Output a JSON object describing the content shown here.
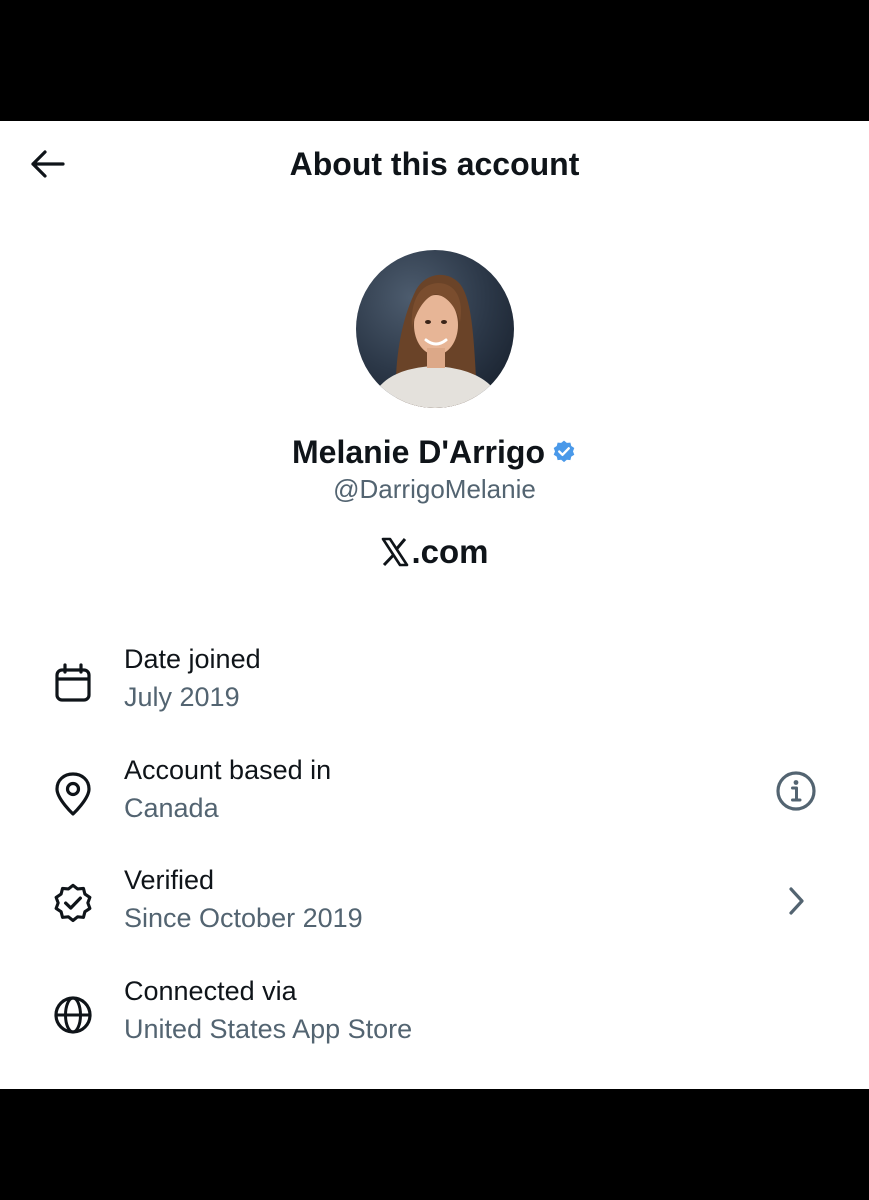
{
  "header": {
    "title": "About this account",
    "back_icon": "arrow-left-icon"
  },
  "profile": {
    "display_name": "Melanie D'Arrigo",
    "handle": "@DarrigoMelanie",
    "verified_color": "#4a99e9",
    "site_mark": "𝕏",
    "site_suffix": ".com"
  },
  "details": [
    {
      "icon": "calendar-icon",
      "label": "Date joined",
      "value": "July 2019"
    },
    {
      "icon": "location-pin-icon",
      "label": "Account based in",
      "value": "Canada",
      "action_icon": "info-icon"
    },
    {
      "icon": "verified-badge-icon",
      "label": "Verified",
      "value": "Since October 2019",
      "action_icon": "chevron-right-icon"
    },
    {
      "icon": "globe-icon",
      "label": "Connected via",
      "value": "United States App Store"
    }
  ],
  "colors": {
    "text_primary": "#0f1419",
    "text_secondary": "#536471",
    "background": "#ffffff",
    "frame": "#000000"
  }
}
